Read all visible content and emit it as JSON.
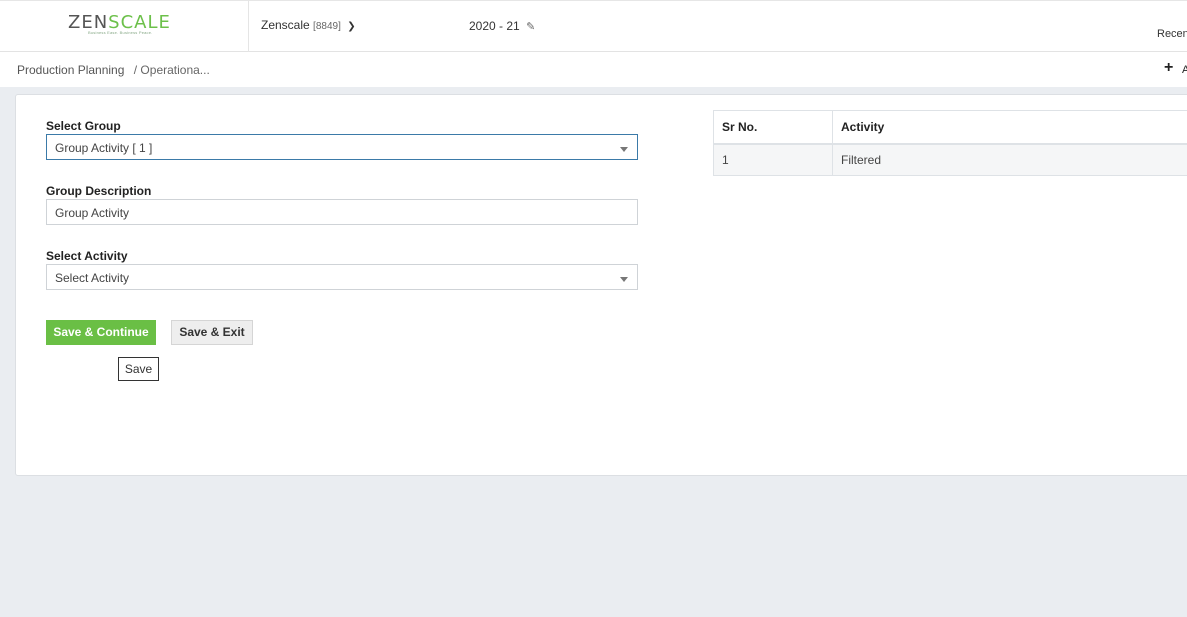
{
  "header": {
    "logo_prefix": "ZEN",
    "logo_suffix": "SCALE",
    "tagline": "Business Ease. Business Peace.",
    "company_name": "Zenscale",
    "company_code": "[8849]",
    "financial_year": "2020 - 21",
    "recent_label": "Recen",
    "icons": {
      "company_dropdown": "chevron-down-icon",
      "fy_edit": "edit-icon"
    }
  },
  "breadcrumb": {
    "root": "Production Planning",
    "current": "/ Operationa...",
    "add_label": "A"
  },
  "form": {
    "select_group_label": "Select Group",
    "select_group_value": "Group Activity [ 1 ]",
    "group_description_label": "Group Description",
    "group_description_value": "Group Activity",
    "select_activity_label": "Select Activity",
    "select_activity_value": "Select Activity",
    "save_continue_label": "Save & Continue",
    "save_exit_label": "Save & Exit",
    "tooltip_text": "Save"
  },
  "table": {
    "headers": [
      "Sr No.",
      "Activity"
    ],
    "rows": [
      [
        "1",
        "Filtered"
      ]
    ]
  },
  "colors": {
    "primary_button": "#6abf45",
    "brand_green": "#6cc04a",
    "page_background": "#eaedf1",
    "focus_border": "#3b7aa8"
  }
}
